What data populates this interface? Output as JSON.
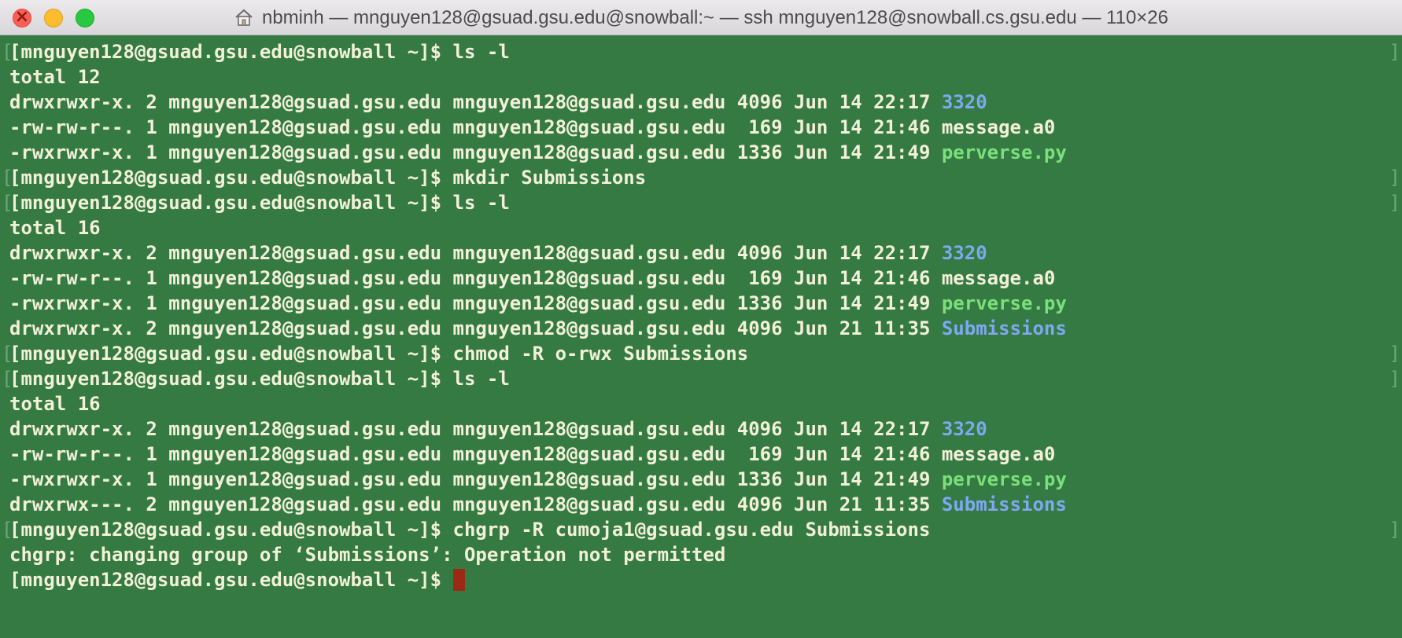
{
  "window": {
    "title": "nbminh — mnguyen128@gsuad.gsu.edu@snowball:~ — ssh mnguyen128@snowball.cs.gsu.edu — 110×26"
  },
  "colors": {
    "background": "#357a43",
    "text": "#f2f0d8",
    "directory": "#7fa8f0",
    "executable": "#7be07b",
    "cursor": "#9b2a14"
  },
  "terminal": {
    "prompt": "[mnguyen128@gsuad.gsu.edu@snowball ~]$ ",
    "lines": [
      {
        "type": "prompt",
        "cmd": "ls -l"
      },
      {
        "type": "text",
        "text": "total 12"
      },
      {
        "type": "ls",
        "prefix": "drwxrwxr-x. 2 mnguyen128@gsuad.gsu.edu mnguyen128@gsuad.gsu.edu 4096 Jun 14 22:17 ",
        "name": "3320",
        "style": "blue"
      },
      {
        "type": "ls",
        "prefix": "-rw-rw-r--. 1 mnguyen128@gsuad.gsu.edu mnguyen128@gsuad.gsu.edu  169 Jun 14 21:46 ",
        "name": "message.a0",
        "style": "plain"
      },
      {
        "type": "ls",
        "prefix": "-rwxrwxr-x. 1 mnguyen128@gsuad.gsu.edu mnguyen128@gsuad.gsu.edu 1336 Jun 14 21:49 ",
        "name": "perverse.py",
        "style": "green"
      },
      {
        "type": "prompt",
        "cmd": "mkdir Submissions"
      },
      {
        "type": "prompt",
        "cmd": "ls -l"
      },
      {
        "type": "text",
        "text": "total 16"
      },
      {
        "type": "ls",
        "prefix": "drwxrwxr-x. 2 mnguyen128@gsuad.gsu.edu mnguyen128@gsuad.gsu.edu 4096 Jun 14 22:17 ",
        "name": "3320",
        "style": "blue"
      },
      {
        "type": "ls",
        "prefix": "-rw-rw-r--. 1 mnguyen128@gsuad.gsu.edu mnguyen128@gsuad.gsu.edu  169 Jun 14 21:46 ",
        "name": "message.a0",
        "style": "plain"
      },
      {
        "type": "ls",
        "prefix": "-rwxrwxr-x. 1 mnguyen128@gsuad.gsu.edu mnguyen128@gsuad.gsu.edu 1336 Jun 14 21:49 ",
        "name": "perverse.py",
        "style": "green"
      },
      {
        "type": "ls",
        "prefix": "drwxrwxr-x. 2 mnguyen128@gsuad.gsu.edu mnguyen128@gsuad.gsu.edu 4096 Jun 21 11:35 ",
        "name": "Submissions",
        "style": "blue"
      },
      {
        "type": "prompt",
        "cmd": "chmod -R o-rwx Submissions"
      },
      {
        "type": "prompt",
        "cmd": "ls -l"
      },
      {
        "type": "text",
        "text": "total 16"
      },
      {
        "type": "ls",
        "prefix": "drwxrwxr-x. 2 mnguyen128@gsuad.gsu.edu mnguyen128@gsuad.gsu.edu 4096 Jun 14 22:17 ",
        "name": "3320",
        "style": "blue"
      },
      {
        "type": "ls",
        "prefix": "-rw-rw-r--. 1 mnguyen128@gsuad.gsu.edu mnguyen128@gsuad.gsu.edu  169 Jun 14 21:46 ",
        "name": "message.a0",
        "style": "plain"
      },
      {
        "type": "ls",
        "prefix": "-rwxrwxr-x. 1 mnguyen128@gsuad.gsu.edu mnguyen128@gsuad.gsu.edu 1336 Jun 14 21:49 ",
        "name": "perverse.py",
        "style": "green"
      },
      {
        "type": "ls",
        "prefix": "drwxrwx---. 2 mnguyen128@gsuad.gsu.edu mnguyen128@gsuad.gsu.edu 4096 Jun 21 11:35 ",
        "name": "Submissions",
        "style": "blue"
      },
      {
        "type": "prompt",
        "cmd": "chgrp -R cumoja1@gsuad.gsu.edu Submissions"
      },
      {
        "type": "text",
        "text": "chgrp: changing group of ‘Submissions’: Operation not permitted"
      },
      {
        "type": "active",
        "cmd": ""
      }
    ]
  }
}
